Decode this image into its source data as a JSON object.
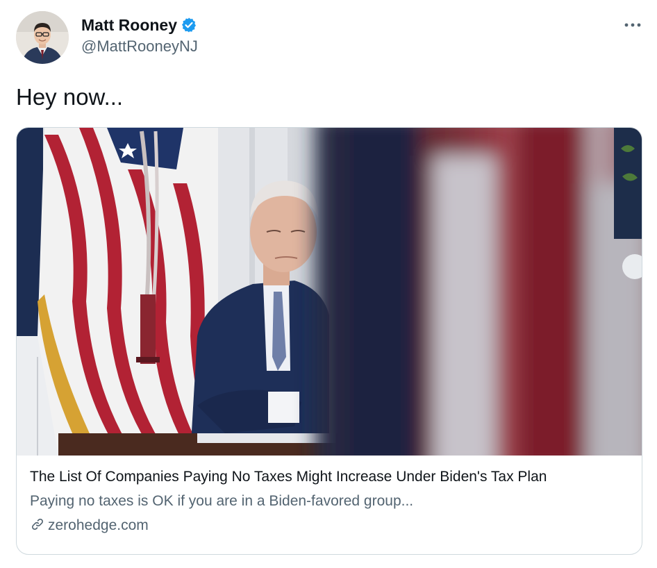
{
  "author": {
    "display_name": "Matt Rooney",
    "handle": "@MattRooneyNJ",
    "verified": true,
    "verified_color": "#1d9bf0"
  },
  "tweet": {
    "text": "Hey now..."
  },
  "card": {
    "title": "The List Of Companies Paying No Taxes Might Increase Under Biden's Tax Plan",
    "description": "Paying no taxes is OK if you are in a Biden-favored group...",
    "domain": "zerohedge.com",
    "link_icon": "link-icon"
  },
  "icons": {
    "more": "more-options-icon",
    "verified": "verified-badge-icon"
  },
  "colors": {
    "text_primary": "#0f1419",
    "text_secondary": "#536471",
    "card_border": "#cfd9de"
  }
}
